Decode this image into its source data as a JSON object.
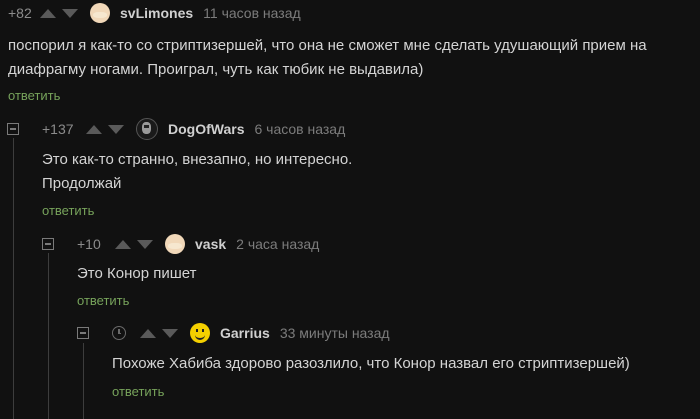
{
  "comments": [
    {
      "rating": "+82",
      "author": "svLimones",
      "time": "11 часов назад",
      "text_lines": [
        "поспорил я как-то со стриптизершей, что она не сможет мне сделать удушающий прием на",
        "диафрагму ногами. Проиграл, чуть как тюбик не выдавила)"
      ],
      "reply": "ответить"
    },
    {
      "rating": "+137",
      "author": "DogOfWars",
      "time": "6 часов назад",
      "text_lines": [
        "Это как-то странно, внезапно, но интересно.",
        "Продолжай"
      ],
      "reply": "ответить"
    },
    {
      "rating": "+10",
      "author": "vask",
      "time": "2 часа назад",
      "text_lines": [
        "Это Конор пишет"
      ],
      "reply": "ответить"
    },
    {
      "rating": "",
      "author": "Garrius",
      "time": "33 минуты назад",
      "text_lines": [
        "Похоже Хабиба здорово разозлило, что Конор назвал его стриптизершей)"
      ],
      "reply": "ответить"
    }
  ],
  "colors": {
    "background": "#111111",
    "reply_link": "#77a35b",
    "rating": "#8c8c8c"
  }
}
